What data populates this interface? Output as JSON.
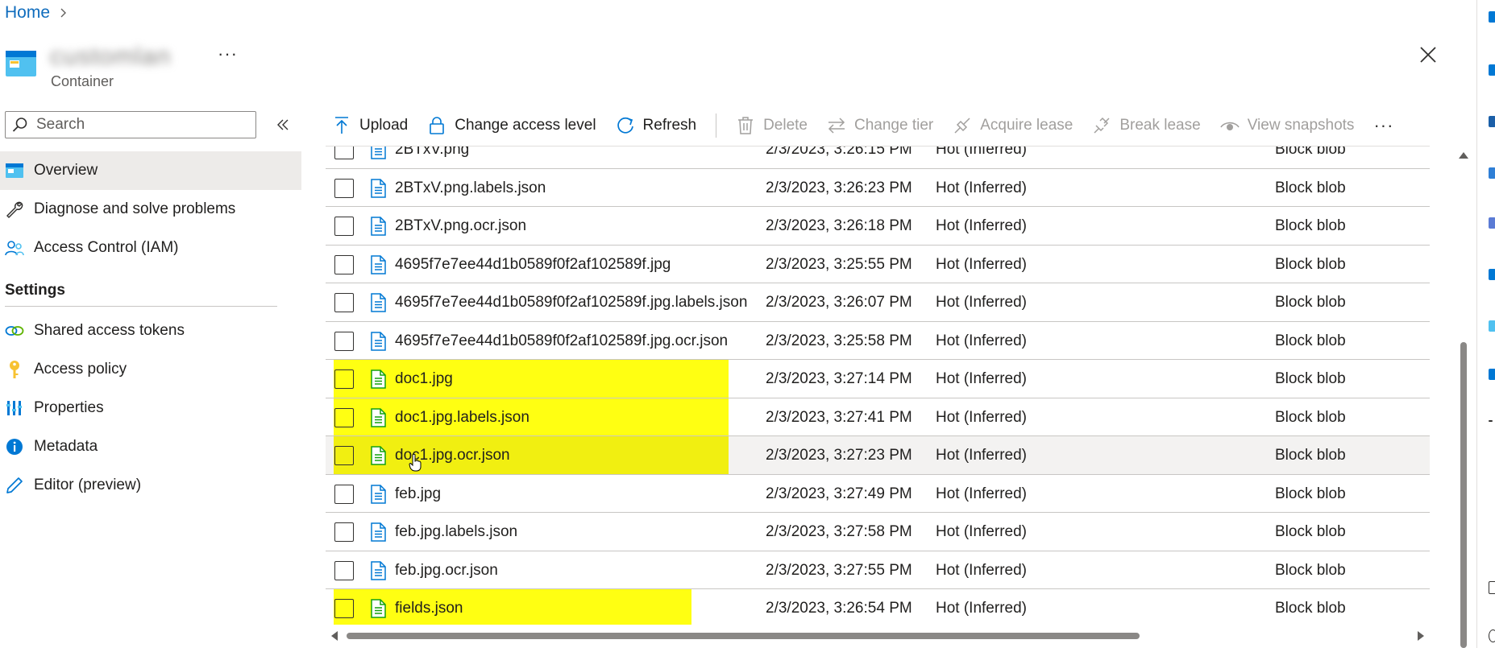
{
  "breadcrumb": {
    "home": "Home"
  },
  "resource": {
    "name": "customlan",
    "type": "Container"
  },
  "sidebar": {
    "search_placeholder": "Search",
    "items": [
      {
        "label": "Overview",
        "icon": "container-icon",
        "active": true
      },
      {
        "label": "Diagnose and solve problems",
        "icon": "wrench-icon"
      },
      {
        "label": "Access Control (IAM)",
        "icon": "people-icon"
      }
    ],
    "settings_heading": "Settings",
    "settings_items": [
      {
        "label": "Shared access tokens",
        "icon": "link-icon"
      },
      {
        "label": "Access policy",
        "icon": "key-icon"
      },
      {
        "label": "Properties",
        "icon": "properties-icon"
      },
      {
        "label": "Metadata",
        "icon": "info-icon"
      },
      {
        "label": "Editor (preview)",
        "icon": "pencil-icon"
      }
    ]
  },
  "toolbar": {
    "upload": "Upload",
    "change_access": "Change access level",
    "refresh": "Refresh",
    "delete": "Delete",
    "change_tier": "Change tier",
    "acquire_lease": "Acquire lease",
    "break_lease": "Break lease",
    "view_snapshots": "View snapshots"
  },
  "colors": {
    "accent": "#0f6cbd",
    "highlight": "#ffff00",
    "file_icon_blue": "#0078d4",
    "file_icon_green": "#13a10e"
  },
  "blobs": [
    {
      "name": "2BTxV.png",
      "modified": "2/3/2023, 3:26:15 PM",
      "tier": "Hot (Inferred)",
      "type": "Block blob",
      "highlight": false,
      "icon": "document-blue"
    },
    {
      "name": "2BTxV.png.labels.json",
      "modified": "2/3/2023, 3:26:23 PM",
      "tier": "Hot (Inferred)",
      "type": "Block blob",
      "highlight": false,
      "icon": "document-blue"
    },
    {
      "name": "2BTxV.png.ocr.json",
      "modified": "2/3/2023, 3:26:18 PM",
      "tier": "Hot (Inferred)",
      "type": "Block blob",
      "highlight": false,
      "icon": "document-blue"
    },
    {
      "name": "4695f7e7ee44d1b0589f0f2af102589f.jpg",
      "modified": "2/3/2023, 3:25:55 PM",
      "tier": "Hot (Inferred)",
      "type": "Block blob",
      "highlight": false,
      "icon": "document-blue"
    },
    {
      "name": "4695f7e7ee44d1b0589f0f2af102589f.jpg.labels.json",
      "modified": "2/3/2023, 3:26:07 PM",
      "tier": "Hot (Inferred)",
      "type": "Block blob",
      "highlight": false,
      "icon": "document-blue"
    },
    {
      "name": "4695f7e7ee44d1b0589f0f2af102589f.jpg.ocr.json",
      "modified": "2/3/2023, 3:25:58 PM",
      "tier": "Hot (Inferred)",
      "type": "Block blob",
      "highlight": false,
      "icon": "document-blue"
    },
    {
      "name": "doc1.jpg",
      "modified": "2/3/2023, 3:27:14 PM",
      "tier": "Hot (Inferred)",
      "type": "Block blob",
      "highlight": true,
      "icon": "document-green"
    },
    {
      "name": "doc1.jpg.labels.json",
      "modified": "2/3/2023, 3:27:41 PM",
      "tier": "Hot (Inferred)",
      "type": "Block blob",
      "highlight": true,
      "icon": "document-green"
    },
    {
      "name": "doc1.jpg.ocr.json",
      "modified": "2/3/2023, 3:27:23 PM",
      "tier": "Hot (Inferred)",
      "type": "Block blob",
      "highlight": true,
      "icon": "document-green",
      "hovered": true
    },
    {
      "name": "feb.jpg",
      "modified": "2/3/2023, 3:27:49 PM",
      "tier": "Hot (Inferred)",
      "type": "Block blob",
      "highlight": false,
      "icon": "document-blue"
    },
    {
      "name": "feb.jpg.labels.json",
      "modified": "2/3/2023, 3:27:58 PM",
      "tier": "Hot (Inferred)",
      "type": "Block blob",
      "highlight": false,
      "icon": "document-blue"
    },
    {
      "name": "feb.jpg.ocr.json",
      "modified": "2/3/2023, 3:27:55 PM",
      "tier": "Hot (Inferred)",
      "type": "Block blob",
      "highlight": false,
      "icon": "document-blue"
    },
    {
      "name": "fields.json",
      "modified": "2/3/2023, 3:26:54 PM",
      "tier": "Hot (Inferred)",
      "type": "Block blob",
      "highlight": true,
      "icon": "document-green"
    }
  ]
}
